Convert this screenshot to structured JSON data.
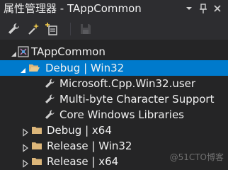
{
  "window": {
    "title": "属性管理器 - TAppCommon",
    "buttons": [
      "chevron-down-icon",
      "pin-icon",
      "close-icon"
    ]
  },
  "toolbar": {
    "buttons": [
      {
        "name": "properties-button",
        "icon": "wrench-icon",
        "enabled": true
      },
      {
        "name": "add-new-property-sheet-button",
        "icon": "wand-icon",
        "enabled": true
      },
      {
        "name": "add-existing-property-sheet-button",
        "icon": "add-sheet-icon",
        "enabled": true
      },
      {
        "name": "save-button",
        "icon": "save-icon",
        "enabled": false
      }
    ]
  },
  "tree": {
    "project": {
      "label": "TAppCommon",
      "expanded": true
    },
    "configurations": [
      {
        "label": "Debug | Win32",
        "expanded": true,
        "selected": true,
        "sheets": [
          {
            "label": "Microsoft.Cpp.Win32.user"
          },
          {
            "label": "Multi-byte Character Support"
          },
          {
            "label": "Core Windows Libraries"
          }
        ]
      },
      {
        "label": "Debug | x64",
        "expanded": false,
        "selected": false
      },
      {
        "label": "Release | Win32",
        "expanded": false,
        "selected": false
      },
      {
        "label": "Release | x64",
        "expanded": false,
        "selected": false
      }
    ]
  },
  "watermark": "@51CTO博客",
  "colors": {
    "background": "#252526",
    "titlebar": "#2d2d30",
    "selection": "#007acc",
    "text": "#f1f1f1",
    "folder": "#dcb67a",
    "icon": "#d0d0d0"
  }
}
